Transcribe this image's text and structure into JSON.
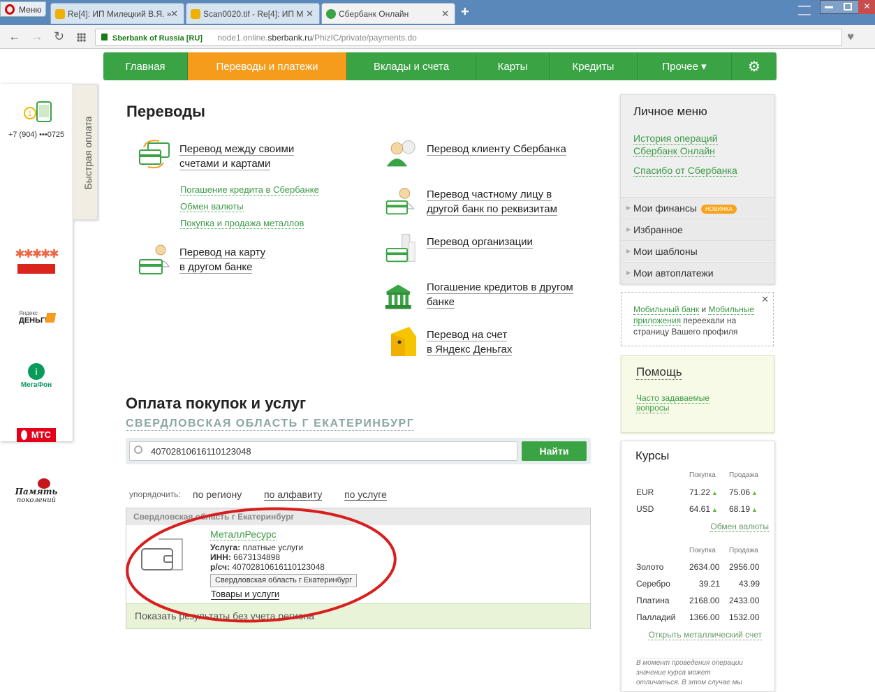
{
  "browser": {
    "menu_label": "Меню",
    "tabs": [
      {
        "label": "Re[4]: ИП Милецкий В.Я. »"
      },
      {
        "label": "Scan0020.tif - Re[4]: ИП М"
      },
      {
        "label": "Сбербанк Онлайн"
      }
    ],
    "new_tab": "+",
    "security_label": "Sberbank of Russia [RU]",
    "url_prefix": "node1.online.",
    "url_domain": "sberbank.ru",
    "url_path": "/PhizIC/private/payments.do"
  },
  "nav": {
    "items": [
      "Главная",
      "Переводы и платежи",
      "Вклады и счета",
      "Карты",
      "Кредиты",
      "Прочее ▾"
    ]
  },
  "quickpay": {
    "tab_label": "Быстрая оплата",
    "phone": "+7 (904) •••0725",
    "yandex_line1": "Яндекс",
    "yandex_line2": "ДЕНЬГИ",
    "megafon": "МегаФон",
    "mts": "МТС",
    "pamyat_line1": "Память",
    "pamyat_line2": "поколений"
  },
  "transfers": {
    "title": "Переводы",
    "own_line1": "Перевод между своими",
    "own_line2": "счетами и картами",
    "sublinks": [
      "Погашение кредита в Сбербанке",
      "Обмен валюты",
      "Покупка и продажа металлов"
    ],
    "card_other_line1": "Перевод на карту",
    "card_other_line2": "в другом банке",
    "client": "Перевод клиенту Сбербанка",
    "private_line1": "Перевод частному лицу в",
    "private_line2": "другой банк по реквизитам",
    "org": "Перевод организации",
    "credit_line1": "Погашение кредитов в другом",
    "credit_line2": "банке",
    "yandex_line1": "Перевод на счет",
    "yandex_line2": "в Яндекс Деньгах"
  },
  "payments": {
    "title": "Оплата покупок и услуг",
    "region": "СВЕРДЛОВСКАЯ ОБЛАСТЬ Г ЕКАТЕРИНБУРГ",
    "search_value": "40702810616110123048",
    "search_button": "Найти",
    "sort_label": "упорядочить:",
    "sort_options": [
      "по региону",
      "по алфавиту",
      "по услуге"
    ],
    "result_header": "Свердловская область г Екатеринбург",
    "result": {
      "name": "МеталлРесурс",
      "service_label": "Услуга:",
      "service_value": "платные услуги",
      "inn_label": "ИНН:",
      "inn_value": "6673134898",
      "account_label": "р/сч:",
      "account_value": "40702810616110123048",
      "region_button": "Свердловская область г Екатеринбург",
      "category": "Товары и услуги"
    },
    "show_all": "Показать результаты без учета региона"
  },
  "sidebar": {
    "menu_title": "Личное меню",
    "link1_line1": "История операций",
    "link1_line2": "Сбербанк Онлайн",
    "link2": "Спасибо от Сбербанка",
    "rows": [
      "Мои финансы",
      "Избранное",
      "Мои шаблоны",
      "Мои автоплатежи"
    ],
    "badge": "НОВИНКА",
    "notice_link1": "Мобильный банк",
    "notice_and": " и ",
    "notice_link2a": "Мобильные",
    "notice_link2b": "приложения",
    "notice_text1": " переехали на",
    "notice_text2": "страницу Вашего профиля",
    "help_title": "Помощь",
    "help_link_line1": "Часто задаваемые",
    "help_link_line2": "вопросы"
  },
  "rates": {
    "title": "Курсы",
    "buy_label": "Покупка",
    "sell_label": "Продажа",
    "currencies": [
      {
        "name": "EUR",
        "buy": "71.22",
        "sell": "75.06"
      },
      {
        "name": "USD",
        "buy": "64.61",
        "sell": "68.19"
      }
    ],
    "exchange_link": "Обмен валюты",
    "metals": [
      {
        "name": "Золото",
        "buy": "2634.00",
        "sell": "2956.00"
      },
      {
        "name": "Серебро",
        "buy": "39.21",
        "sell": "43.99"
      },
      {
        "name": "Платина",
        "buy": "2168.00",
        "sell": "2433.00"
      },
      {
        "name": "Палладий",
        "buy": "1366.00",
        "sell": "1532.00"
      }
    ],
    "metal_link": "Открыть металлический счет",
    "note_line1": "В момент проведения операции",
    "note_line2": "значение курса может",
    "note_line3": "отличаться. В этом случае мы"
  },
  "colors": {
    "green": "#3aa445",
    "orange": "#f59c1d",
    "annotation": "#d81e1e"
  }
}
